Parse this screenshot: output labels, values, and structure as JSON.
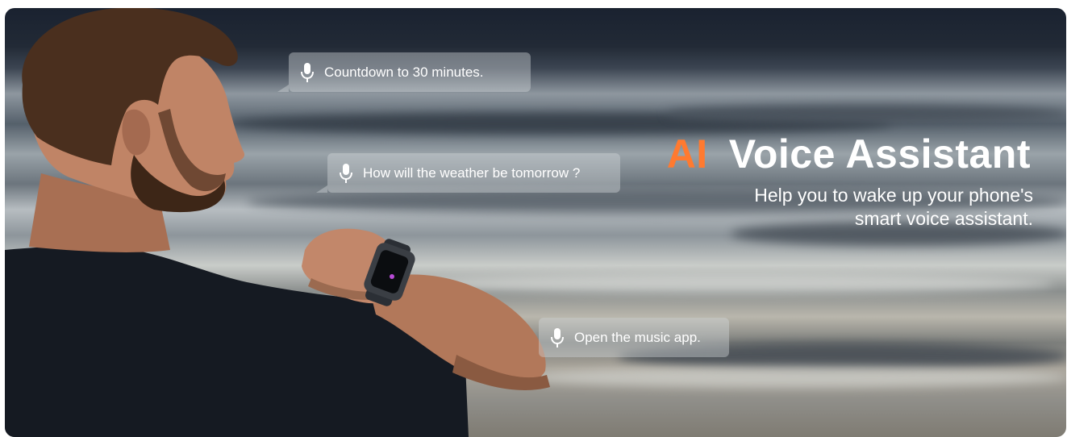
{
  "banner": {
    "title_accent": "AI",
    "title_rest": "Voice Assistant",
    "subtitle_line1": "Help you to wake up your phone's",
    "subtitle_line2": "smart voice assistant.",
    "accent_color": "#ff7a30"
  },
  "bubbles": [
    {
      "text": "Countdown to 30 minutes.",
      "icon": "microphone-icon"
    },
    {
      "text": "How will the weather be tomorrow ?",
      "icon": "microphone-icon"
    },
    {
      "text": "Open the music app.",
      "icon": "microphone-icon"
    }
  ]
}
